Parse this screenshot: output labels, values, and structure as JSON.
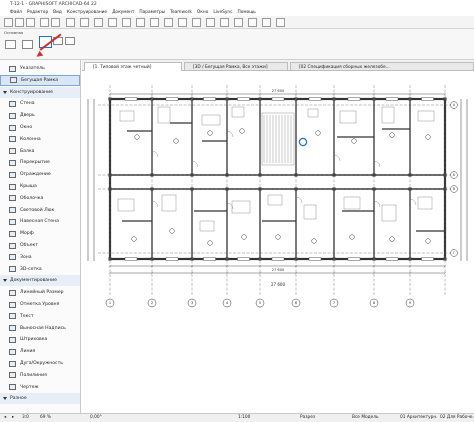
{
  "window": {
    "title": "T-12-1 - GRAPHISOFT ARCHICAD-64 22"
  },
  "menu": [
    "Файл",
    "Редактор",
    "Вид",
    "Конструирование",
    "Документ",
    "Параметры",
    "Teamwork",
    "Окно",
    "LiveSync",
    "Помощь"
  ],
  "infobox": {
    "label": "Основная"
  },
  "tabs": [
    {
      "label": "[1. Типовой этаж четный]"
    },
    {
      "label": "[3D / Бегущая Рамка, Все этажи]"
    },
    {
      "label": "[02 Спецификация сборных железобе..."
    }
  ],
  "sidebar": {
    "pointer": "Указатель",
    "marquee": "Бегущая Рамка",
    "section_design": "Конструирование",
    "design_items": [
      "Стена",
      "Дверь",
      "Окно",
      "Колонна",
      "Балка",
      "Перекрытие",
      "Ограждение",
      "Крыша",
      "Оболочка",
      "Световой Люк",
      "Навесная Стена",
      "Морф",
      "Объект",
      "Зона",
      "3D-сетка"
    ],
    "section_doc": "Документирование",
    "doc_items": [
      "Линейный Размер",
      "Отметка Уровня",
      "Текст",
      "Выносная Надпись",
      "Штриховка",
      "Линия",
      "Дуга/Окружность",
      "Полилиния",
      "Чертеж"
    ],
    "bottom": "Разное"
  },
  "drawing": {
    "dim_total_top": "27 600",
    "dim_total_bottom": "27 600",
    "axes_numbers": [
      "1",
      "2",
      "3",
      "4",
      "5",
      "6",
      "7",
      "8",
      "9"
    ],
    "axes_letters": [
      "А",
      "Б",
      "В",
      "Г"
    ]
  },
  "status": {
    "nav": "3:0",
    "zoom": "69 %",
    "angle": "0,00°",
    "scale": "1:100",
    "layer_combo": "Разрез",
    "model": "Все Модель",
    "mvo": "01 Архитектурн...",
    "dims": "02 Для Рабоче..."
  },
  "colors": {
    "accent": "#1e6fcf",
    "arrow": "#d32f2f",
    "wall": "#555555"
  }
}
